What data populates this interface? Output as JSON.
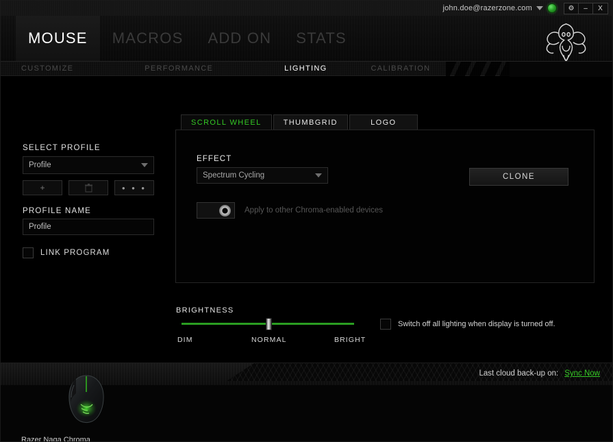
{
  "titlebar": {
    "account_email": "john.doe@razerzone.com",
    "caret_icon": "chevron-down-icon",
    "status_orb_icon": "status-online-icon",
    "buttons": [
      {
        "label": "⚙",
        "name": "settings-button"
      },
      {
        "label": "–",
        "name": "minimize-button"
      },
      {
        "label": "X",
        "name": "close-button"
      }
    ]
  },
  "header": {
    "logo_icon": "razer-logo",
    "main_nav": [
      {
        "label": "MOUSE",
        "active": true
      },
      {
        "label": "MACROS",
        "active": false
      },
      {
        "label": "ADD ON",
        "active": false
      },
      {
        "label": "STATS",
        "active": false
      }
    ],
    "sub_nav": [
      {
        "label": "CUSTOMIZE",
        "active": false
      },
      {
        "label": "PERFORMANCE",
        "active": false
      },
      {
        "label": "LIGHTING",
        "active": true
      },
      {
        "label": "CALIBRATION",
        "active": false
      }
    ]
  },
  "sidebar": {
    "select_profile_label": "SELECT PROFILE",
    "profile_value": "Profile",
    "buttons": [
      {
        "label": "+",
        "name": "add-profile-button"
      },
      {
        "label": "▮",
        "name": "delete-profile-button"
      },
      {
        "label": "• • •",
        "name": "more-options-button"
      }
    ],
    "profile_name_label": "PROFILE NAME",
    "profile_name_value": "Profile",
    "link_program_label": "LINK PROGRAM",
    "link_program_checked": false
  },
  "content": {
    "tabs": [
      {
        "label": "SCROLL WHEEL",
        "active": true
      },
      {
        "label": "THUMBGRID",
        "active": false
      },
      {
        "label": "LOGO",
        "active": false
      }
    ],
    "effect_label": "EFFECT",
    "effect_value": "Spectrum Cycling",
    "apply_toggle_label": "Apply to other Chroma-enabled devices",
    "apply_toggle_on": false,
    "clone_label": "CLONE"
  },
  "brightness": {
    "label": "BRIGHTNESS",
    "ticks": {
      "dim": "DIM",
      "normal": "NORMAL",
      "bright": "BRIGHT"
    },
    "value_label": "NORMAL",
    "switch_off_label": "Switch off all lighting when display is turned off.",
    "switch_off_checked": false
  },
  "footer": {
    "backup_text": "Last cloud back-up on:",
    "sync_label": "Sync Now",
    "device_name": "Razer Naga Chroma"
  },
  "colors": {
    "accent_green": "#35c925",
    "slider_green": "#2a9e21",
    "background": "#000000"
  }
}
